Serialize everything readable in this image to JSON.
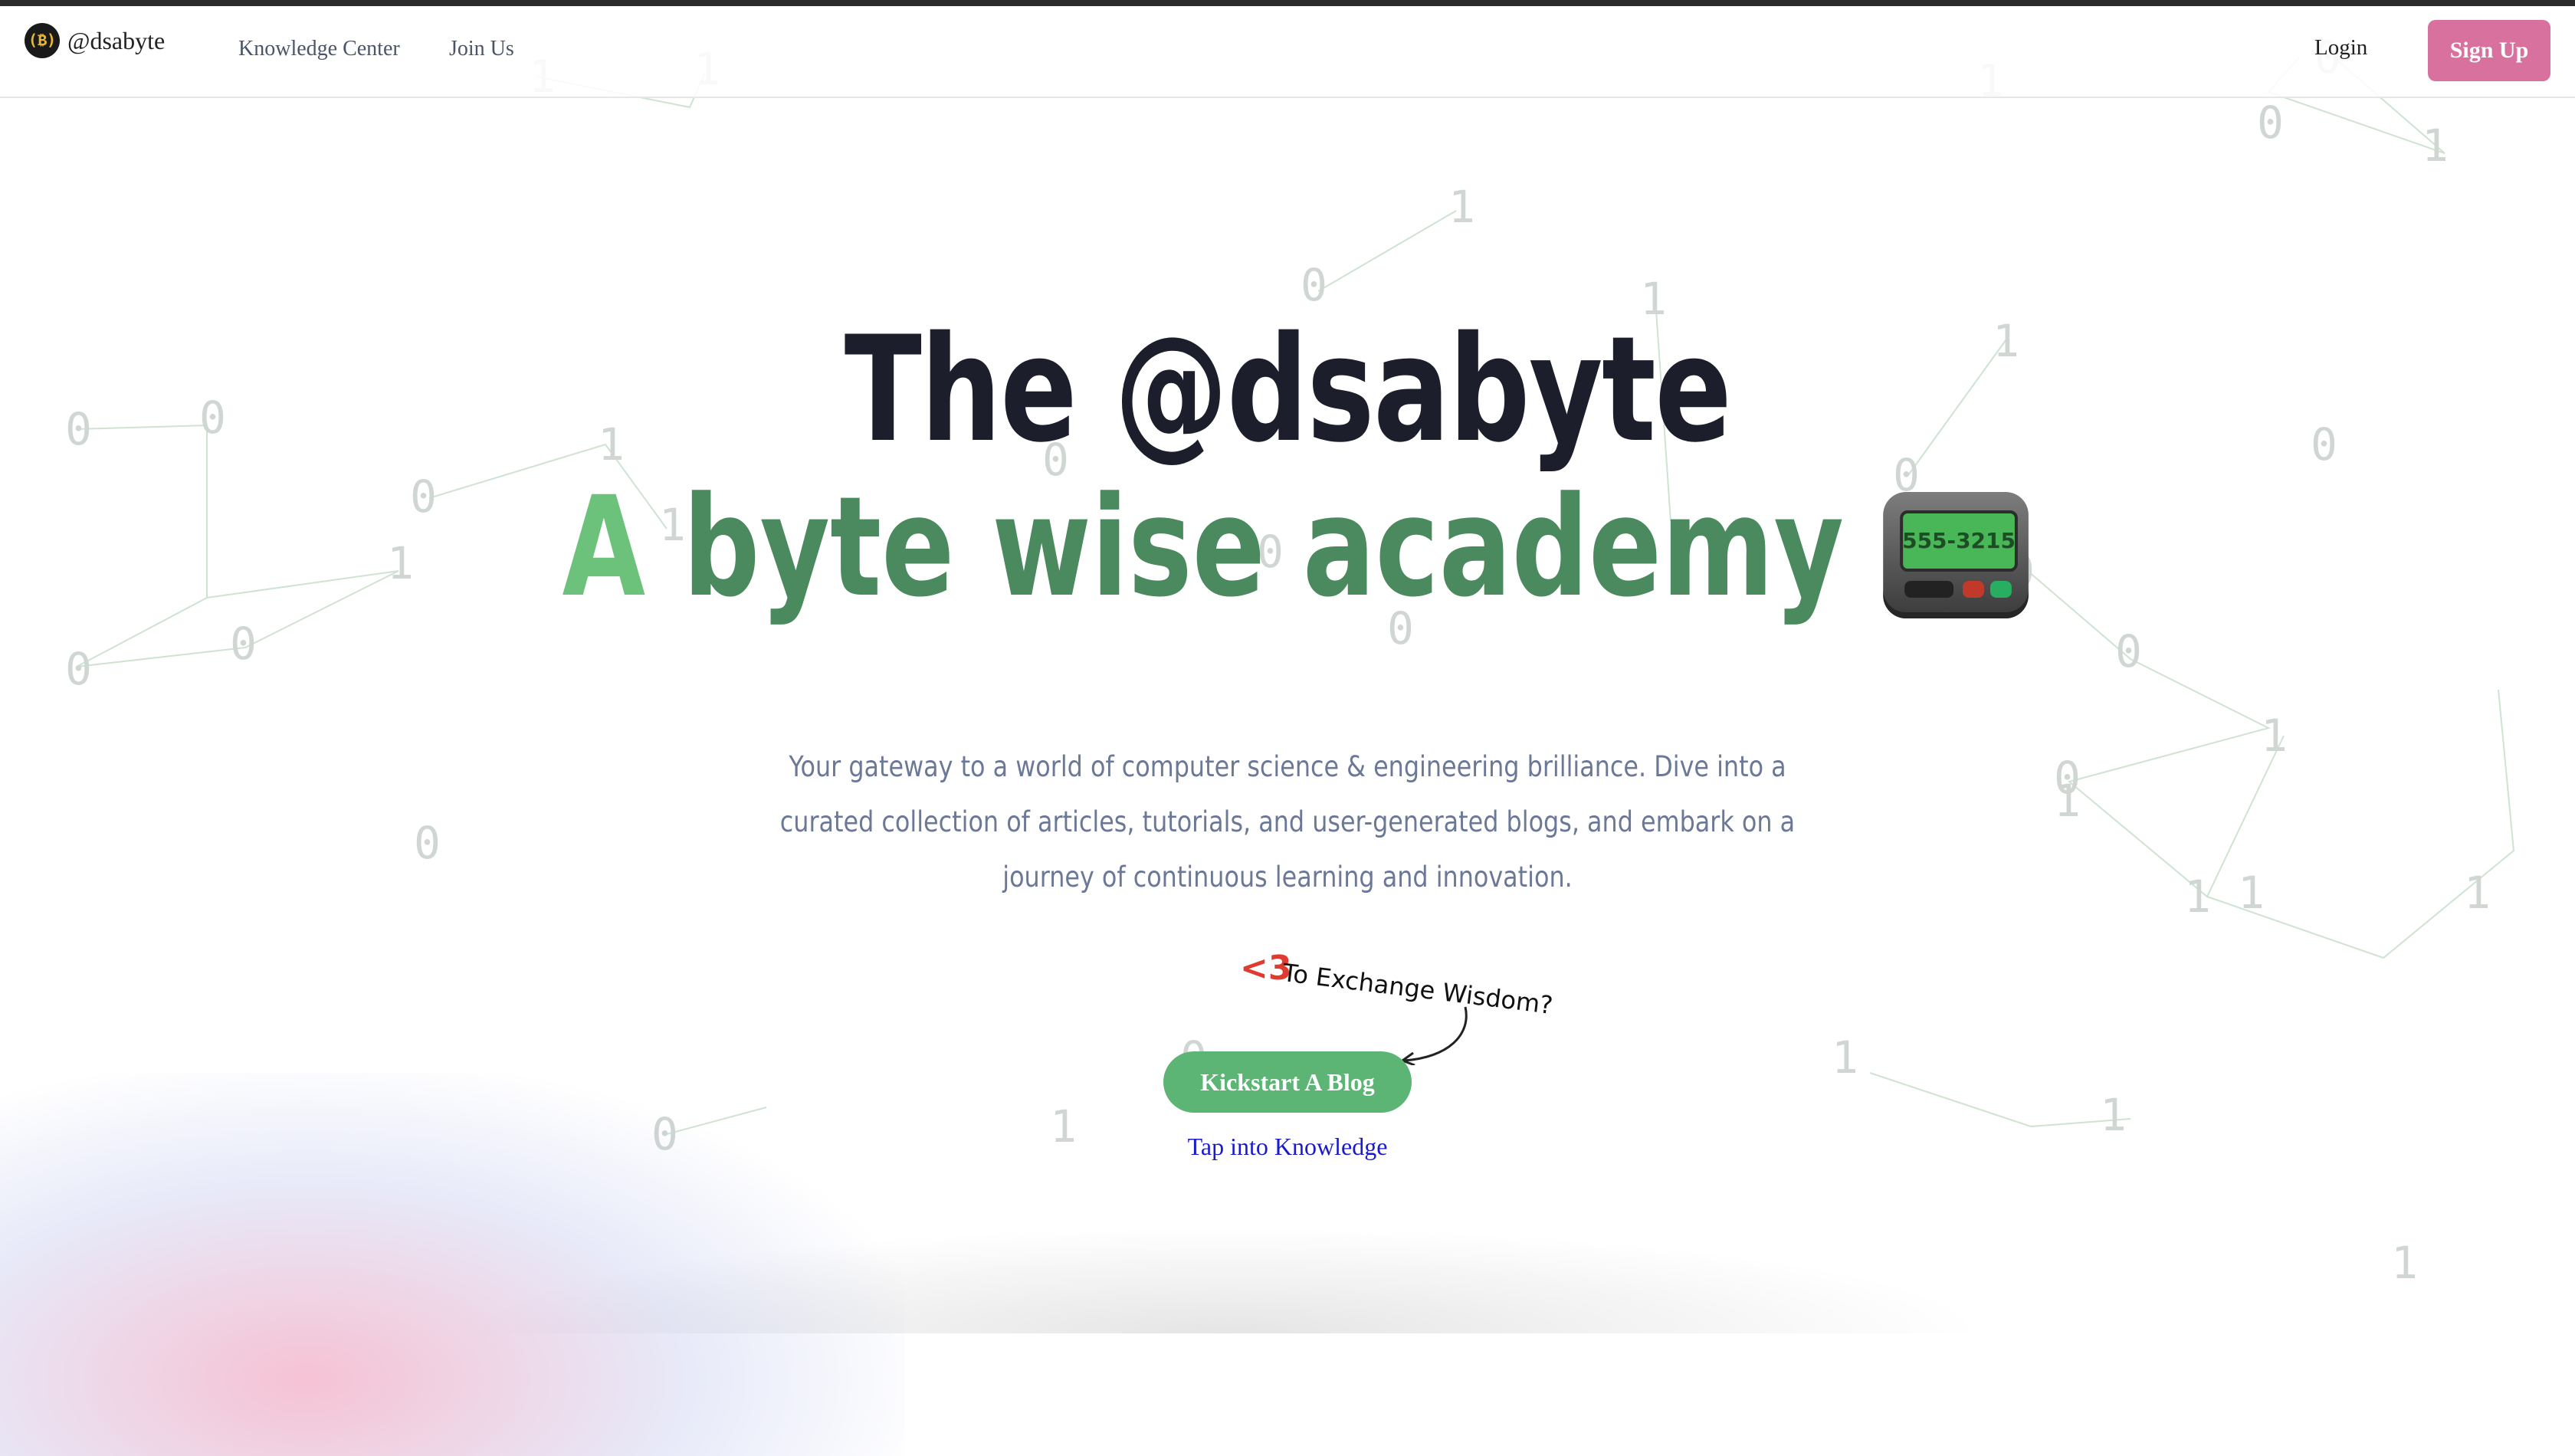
{
  "navbar": {
    "brand": "@dsabyte",
    "links": [
      "Knowledge Center",
      "Join Us"
    ],
    "login": "Login",
    "signup": "Sign Up"
  },
  "hero": {
    "title_line1": "The @dsabyte",
    "title_line2_first": "A",
    "title_line2_rest": " byte wise academy",
    "pager_display": "555-3215",
    "subtitle": "Your gateway to a world of computer science & engineering brilliance. Dive into a curated collection of articles, tutorials, and user-generated blogs, and embark on a journey of continuous learning and innovation.",
    "heart": "<3",
    "exchange_note": "To Exchange Wisdom?",
    "cta_label": "Kickstart A Blog",
    "secondary_link": "Tap into Knowledge"
  },
  "icons": {
    "logo": "bitcoin-style-logo-icon",
    "pager": "pager-emoji-icon",
    "arrow": "curved-arrow-icon"
  },
  "colors": {
    "brand_pink": "#d9719f",
    "brand_green": "#5cb574",
    "title_dark": "#1c1f2b",
    "title_green": "#4a8a5e",
    "link_blue": "#1a1acc"
  }
}
